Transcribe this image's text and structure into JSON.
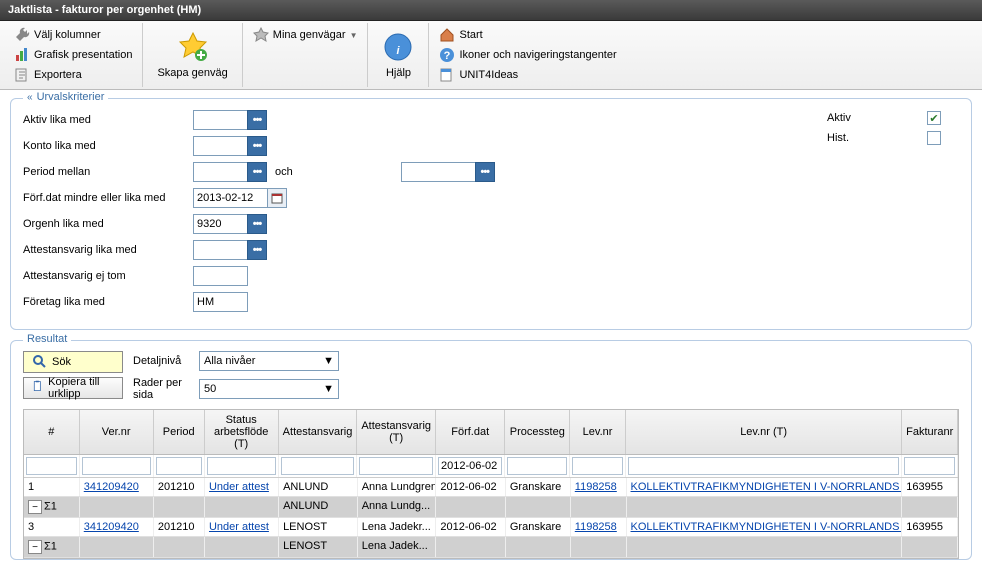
{
  "title": "Jaktlista - fakturor per orgenhet (HM)",
  "toolbar": {
    "valj_kolumner": "Välj kolumner",
    "grafisk": "Grafisk presentation",
    "exportera": "Exportera",
    "skapa_genvag": "Skapa genväg",
    "mina_genvagar": "Mina genvägar",
    "hjalp": "Hjälp",
    "start": "Start",
    "ikoner": "Ikoner och navigeringstangenter",
    "unit4ideas": "UNIT4Ideas"
  },
  "criteria": {
    "legend": "Urvalskriterier",
    "aktiv_label": "Aktiv lika med",
    "konto_label": "Konto lika med",
    "period_label": "Period mellan",
    "och": "och",
    "forfdat_label": "Förf.dat mindre eller lika med",
    "forfdat_value": "2013-02-12",
    "orgenh_label": "Orgenh lika med",
    "orgenh_value": "9320",
    "attest_label": "Attestansvarig lika med",
    "attest_ej_label": "Attestansvarig ej tom",
    "foretag_label": "Företag lika med",
    "foretag_value": "HM",
    "aktiv_chk": "Aktiv",
    "hist_chk": "Hist."
  },
  "result": {
    "legend": "Resultat",
    "sok": "Sök",
    "kopiera": "Kopiera till urklipp",
    "detaljniva_label": "Detaljnivå",
    "detaljniva_value": "Alla nivåer",
    "rader_label": "Rader per sida",
    "rader_value": "50"
  },
  "grid": {
    "headers": [
      "#",
      "Ver.nr",
      "Period",
      "Status arbetsflöde (T)",
      "Attestansvarig",
      "Attestansvarig (T)",
      "Förf.dat",
      "Processteg",
      "Lev.nr",
      "Lev.nr (T)",
      "Fakturanr"
    ],
    "filter_forfdat": "2012-06-02",
    "rows": [
      {
        "num": "1",
        "ver": "341209420",
        "period": "201210",
        "status": "Under attest",
        "att": "ANLUND",
        "att_t": "Anna Lundgren",
        "forf": "2012-06-02",
        "proc": "Granskare",
        "lev": "1198258",
        "lev_t": "KOLLEKTIVTRAFIKMYNDIGHETEN I V-NORRLANDS LÄN",
        "fakt": "163955"
      },
      {
        "sum": true,
        "num": "Σ1",
        "att": "ANLUND",
        "att_t": "Anna Lundg..."
      },
      {
        "num": "3",
        "ver": "341209420",
        "period": "201210",
        "status": "Under attest",
        "att": "LENOST",
        "att_t": "Lena Jadekr...",
        "forf": "2012-06-02",
        "proc": "Granskare",
        "lev": "1198258",
        "lev_t": "KOLLEKTIVTRAFIKMYNDIGHETEN I V-NORRLANDS LÄN",
        "fakt": "163955"
      },
      {
        "sum": true,
        "num": "Σ1",
        "att": "LENOST",
        "att_t": "Lena Jadek..."
      }
    ]
  }
}
